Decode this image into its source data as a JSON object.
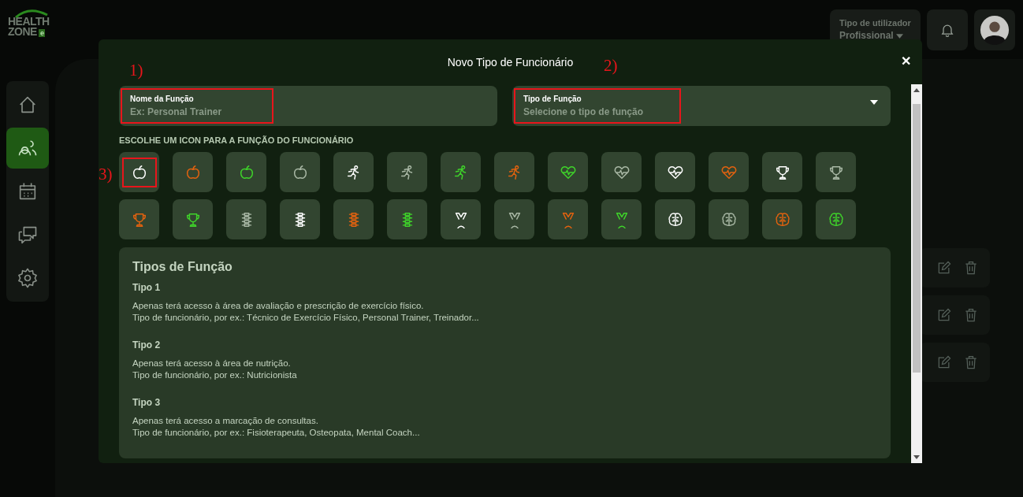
{
  "logo": {
    "line1": "HEALTH",
    "line2": "ZONE",
    "badge": "e"
  },
  "user_type": {
    "label": "Tipo de utilizador",
    "value": "Profissional"
  },
  "sidebar": {
    "items": [
      {
        "kind": "home",
        "selected": false
      },
      {
        "kind": "users",
        "selected": true
      },
      {
        "kind": "calendar",
        "selected": false
      },
      {
        "kind": "chat",
        "selected": false
      },
      {
        "kind": "settings",
        "selected": false
      }
    ]
  },
  "background_rows": [
    {
      "kind": "row"
    },
    {
      "kind": "row"
    },
    {
      "kind": "row"
    }
  ],
  "modal": {
    "title": "Novo Tipo de Funcionário",
    "close": "✕",
    "name_field": {
      "label": "Nome da Função",
      "placeholder": "Ex: Personal Trainer",
      "annotation": "1)",
      "highlighted": true
    },
    "type_field": {
      "label": "Tipo de Função",
      "placeholder": "Selecione o tipo de função",
      "annotation": "2)",
      "highlighted": true
    },
    "icons_heading": "ESCOLHE UM ICON PARA A FUNÇÃO DO FUNCIONÁRIO",
    "icons_annotation": "3)",
    "icons": [
      {
        "kind": "apple",
        "color": "#ffffff",
        "highlighted": true
      },
      {
        "kind": "apple",
        "color": "#e2620f",
        "highlighted": false
      },
      {
        "kind": "apple",
        "color": "#3fd42a",
        "highlighted": false
      },
      {
        "kind": "apple",
        "color": "#a9b8a5",
        "highlighted": false
      },
      {
        "kind": "runner",
        "color": "#ffffff",
        "highlighted": false
      },
      {
        "kind": "runner",
        "color": "#a9b8a5",
        "highlighted": false
      },
      {
        "kind": "runner",
        "color": "#3fd42a",
        "highlighted": false
      },
      {
        "kind": "runner",
        "color": "#e2620f",
        "highlighted": false
      },
      {
        "kind": "heart",
        "color": "#3fd42a",
        "highlighted": false
      },
      {
        "kind": "heart",
        "color": "#a9b8a5",
        "highlighted": false
      },
      {
        "kind": "heart",
        "color": "#ffffff",
        "highlighted": false
      },
      {
        "kind": "heart",
        "color": "#e2620f",
        "highlighted": false
      },
      {
        "kind": "trophy",
        "color": "#ffffff",
        "highlighted": false
      },
      {
        "kind": "trophy",
        "color": "#a9b8a5",
        "highlighted": false
      },
      {
        "kind": "trophy",
        "color": "#e2620f",
        "highlighted": false
      },
      {
        "kind": "trophy",
        "color": "#3fd42a",
        "highlighted": false
      },
      {
        "kind": "spine",
        "color": "#a9b8a5",
        "highlighted": false
      },
      {
        "kind": "spine",
        "color": "#ffffff",
        "highlighted": false
      },
      {
        "kind": "spine",
        "color": "#e2620f",
        "highlighted": false
      },
      {
        "kind": "spine",
        "color": "#3fd42a",
        "highlighted": false
      },
      {
        "kind": "medal",
        "color": "#ffffff",
        "highlighted": false
      },
      {
        "kind": "medal",
        "color": "#a9b8a5",
        "highlighted": false
      },
      {
        "kind": "medal",
        "color": "#e2620f",
        "highlighted": false
      },
      {
        "kind": "medal",
        "color": "#3fd42a",
        "highlighted": false
      },
      {
        "kind": "brain",
        "color": "#ffffff",
        "highlighted": false
      },
      {
        "kind": "brain",
        "color": "#a9b8a5",
        "highlighted": false
      },
      {
        "kind": "brain",
        "color": "#e2620f",
        "highlighted": false
      },
      {
        "kind": "brain",
        "color": "#3fd42a",
        "highlighted": false
      }
    ],
    "info": {
      "title": "Tipos de Função",
      "types": [
        {
          "name": "Tipo 1",
          "lines": [
            "Apenas terá acesso à área de avaliação e prescrição de exercício físico.",
            "Tipo de funcionário, por ex.: Técnico de Exercício Físico, Personal Trainer, Treinador..."
          ]
        },
        {
          "name": "Tipo 2",
          "lines": [
            "Apenas terá acesso à área de nutrição.",
            "Tipo de funcionário, por ex.: Nutricionista"
          ]
        },
        {
          "name": "Tipo 3",
          "lines": [
            "Apenas terá acesso a marcação de consultas.",
            "Tipo de funcionário, por ex.: Fisioterapeuta, Osteopata, Mental Coach..."
          ]
        }
      ]
    }
  }
}
